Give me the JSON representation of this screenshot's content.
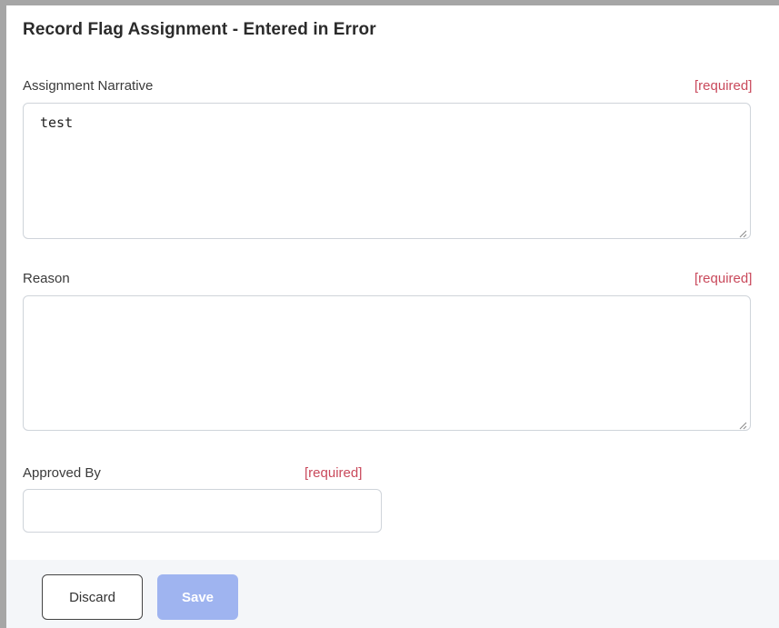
{
  "form": {
    "title": "Record Flag Assignment - Entered in Error",
    "fields": {
      "assignment_narrative": {
        "label": "Assignment Narrative",
        "required_text": "[required]",
        "value": "test"
      },
      "reason": {
        "label": "Reason",
        "required_text": "[required]",
        "value": ""
      },
      "approved_by": {
        "label": "Approved By",
        "required_text": "[required]",
        "value": ""
      }
    }
  },
  "footer": {
    "discard_label": "Discard",
    "save_label": "Save"
  },
  "colors": {
    "required": "#c9495b",
    "save_disabled": "#9fb4f0",
    "frame_border": "#a6a6a6"
  },
  "icons": {
    "textarea_resize": "resize-grip-icon"
  }
}
